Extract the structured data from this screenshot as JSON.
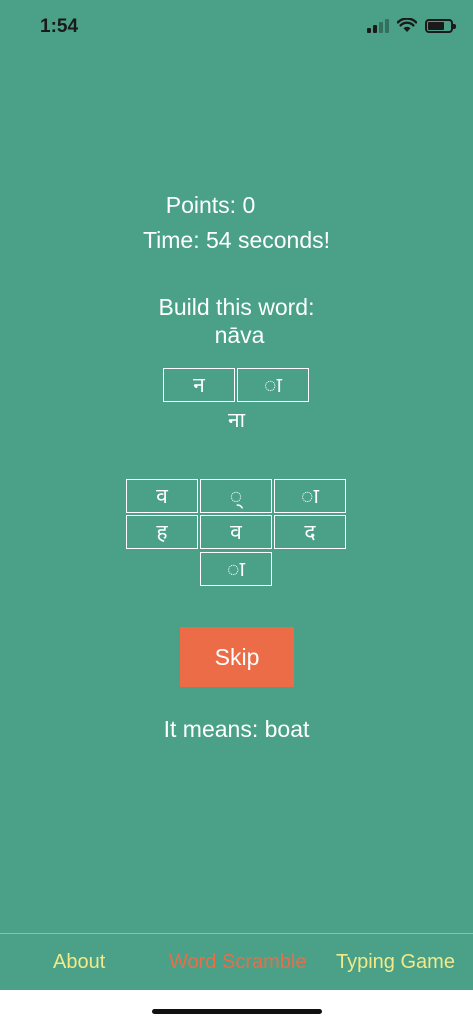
{
  "status": {
    "time": "1:54"
  },
  "game": {
    "points": "Points: 0",
    "time": "Time: 54 seconds!",
    "prompt": "Build this word:",
    "word": "nāva",
    "built_tiles": [
      "न",
      "ा"
    ],
    "built_preview": "ना",
    "letter_tiles_row1": [
      "व",
      "्",
      "ा"
    ],
    "letter_tiles_row2": [
      "ह",
      "व",
      "द"
    ],
    "letter_tiles_row3": [
      "ा"
    ],
    "skip_label": "Skip",
    "meaning": "It means: boat"
  },
  "tabs": [
    {
      "label": "About",
      "color": "#f2e98a"
    },
    {
      "label": "Word Scramble",
      "color": "#ec6c48",
      "selected": true
    },
    {
      "label": "Typing Game",
      "color": "#f2e98a"
    }
  ],
  "colors": {
    "background": "#4aa187",
    "accent": "#ec6c48",
    "tab": "#f2e98a"
  }
}
